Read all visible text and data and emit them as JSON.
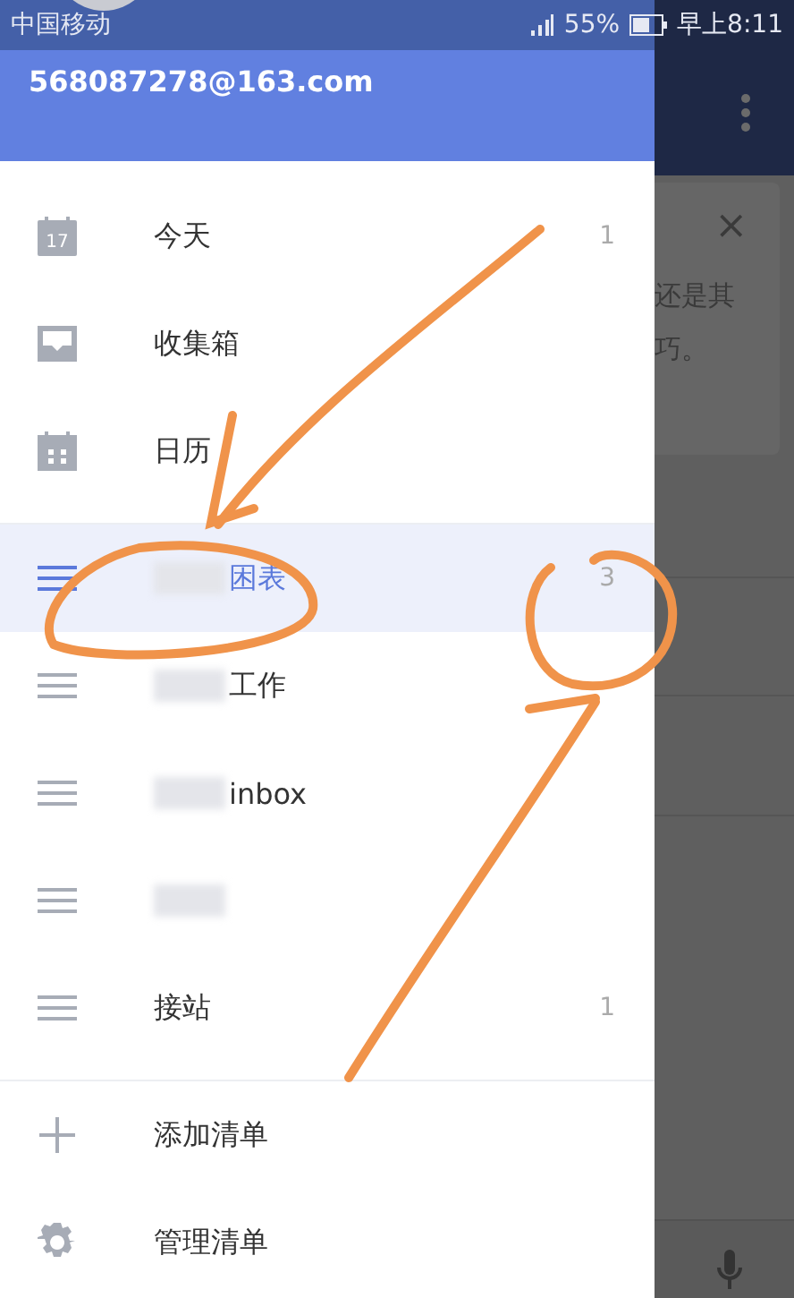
{
  "status_bar": {
    "carrier": "中国移动",
    "battery": "55%",
    "time": "早上8:11"
  },
  "account": {
    "email": "568087278@163.com"
  },
  "nav": [
    {
      "kind": "today",
      "icon_text": "17",
      "label": "今天",
      "count": "1"
    },
    {
      "kind": "inbox",
      "label": "收集箱"
    },
    {
      "kind": "calendar",
      "label": "日历"
    }
  ],
  "lists": [
    {
      "label": "困表",
      "count": "3",
      "selected": true,
      "redacted": true
    },
    {
      "label": "工作",
      "selected": false,
      "redacted": true
    },
    {
      "label": "inbox",
      "selected": false,
      "redacted": true
    },
    {
      "selected": false,
      "redacted": true
    },
    {
      "label": "接站",
      "count": "1",
      "selected": false,
      "redacted": false
    }
  ],
  "actions": [
    {
      "kind": "add",
      "label": "添加清单"
    },
    {
      "kind": "manage",
      "label": "管理清单"
    }
  ],
  "background": {
    "close": "×",
    "card_text": [
      "还是其",
      "巧。"
    ]
  }
}
